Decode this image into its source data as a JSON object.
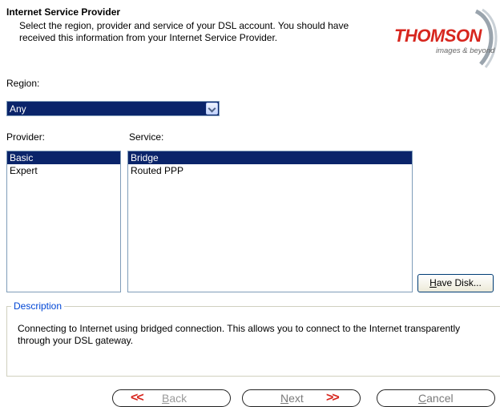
{
  "header": {
    "title": "Internet Service Provider",
    "subtitle": "Select the region, provider and service of your DSL account. You should have received this information from your Internet Service Provider."
  },
  "logo": {
    "brand": "THOMSON",
    "tagline": "images & beyond"
  },
  "region": {
    "label": "Region:",
    "selected": "Any"
  },
  "provider": {
    "label": "Provider:",
    "items": [
      "Basic",
      "Expert"
    ],
    "selected_index": 0
  },
  "service": {
    "label": "Service:",
    "items": [
      "Bridge",
      "Routed PPP"
    ],
    "selected_index": 0
  },
  "have_disk": {
    "label": "Have Disk...",
    "mnemonic": "H",
    "rest": "ave Disk..."
  },
  "description": {
    "label": "Description",
    "text": "Connecting to Internet using bridged connection. This allows you to connect to the Internet transparently through your DSL gateway."
  },
  "nav": {
    "back": {
      "arrow": "<<",
      "mnemonic": "B",
      "rest": "ack"
    },
    "next": {
      "arrow": ">>",
      "mnemonic": "N",
      "rest": "ext"
    },
    "cancel": {
      "mnemonic": "C",
      "rest": "ancel"
    }
  },
  "colors": {
    "selection": "#0a246a",
    "brand": "#d7261e",
    "group_label": "#0046d5"
  }
}
